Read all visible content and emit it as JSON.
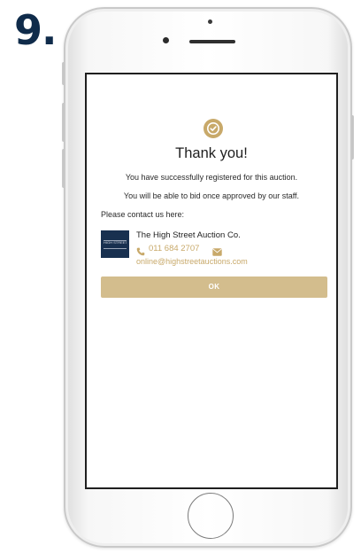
{
  "step": {
    "number": "9."
  },
  "dialog": {
    "title": "Thank you!",
    "message_registered": "You have successfully registered for this auction.",
    "message_approval": "You will be able to bid once approved by our staff.",
    "contact_label": "Please contact us here:",
    "company": {
      "name": "The High Street Auction Co.",
      "logo_text": "HIGH STREET",
      "phone": "011 684 2707",
      "email": "online@highstreetauctions.com"
    },
    "ok_label": "OK"
  },
  "icons": {
    "success": "check-circle-icon",
    "phone": "phone-icon",
    "mail": "mail-icon"
  },
  "colors": {
    "accent": "#c8a96a",
    "button": "#d3bd8d",
    "step_number": "#0f2b4a",
    "logo_background": "#18304f"
  }
}
